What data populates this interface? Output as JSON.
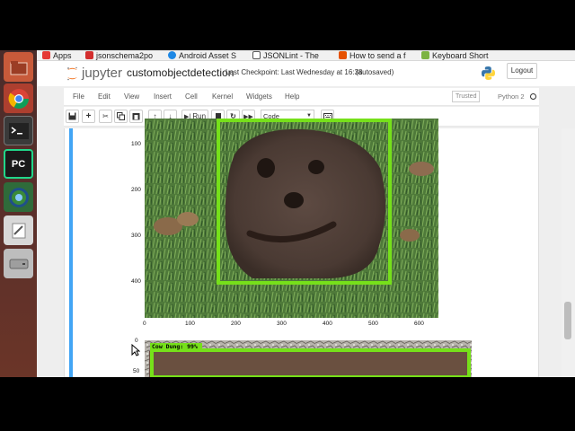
{
  "bookmarks": [
    {
      "label": "Apps",
      "color": "#e53935",
      "icon": "apps-grid-icon"
    },
    {
      "label": "jsonschema2po",
      "color": "#d32f2f",
      "icon": "flag-icon"
    },
    {
      "label": "Android Asset S",
      "color": "#1e88e5",
      "icon": "android-asset-icon"
    },
    {
      "label": "JSONLint - The",
      "color": "#555555",
      "icon": "braces-icon"
    },
    {
      "label": "How to send a f",
      "color": "#e65100",
      "icon": "stackoverflow-icon"
    },
    {
      "label": "Keyboard Short",
      "color": "#7cb342",
      "icon": "android-icon"
    }
  ],
  "jupyter": {
    "logo_text": "jupyter",
    "notebook_name": "customobjectdetection",
    "checkpoint": "Last Checkpoint: Last Wednesday at 16:38",
    "autosave": "(autosaved)",
    "logout": "Logout",
    "trusted": "Trusted",
    "kernel": "Python 2"
  },
  "menu": [
    "File",
    "Edit",
    "View",
    "Insert",
    "Cell",
    "Kernel",
    "Widgets",
    "Help"
  ],
  "toolbar": {
    "run_label": "Run",
    "cell_type": "Code"
  },
  "plot1": {
    "y_ticks": [
      "100",
      "200",
      "300",
      "400"
    ],
    "x_ticks": [
      "0",
      "100",
      "200",
      "300",
      "400",
      "500",
      "600"
    ],
    "box_color": "#76e01a"
  },
  "plot2": {
    "y_ticks": [
      "0",
      "50"
    ],
    "detection_label": "Cow Dung: 99%"
  },
  "colors": {
    "jupyter_orange": "#f37726",
    "cell_selected": "#42a5f5"
  }
}
